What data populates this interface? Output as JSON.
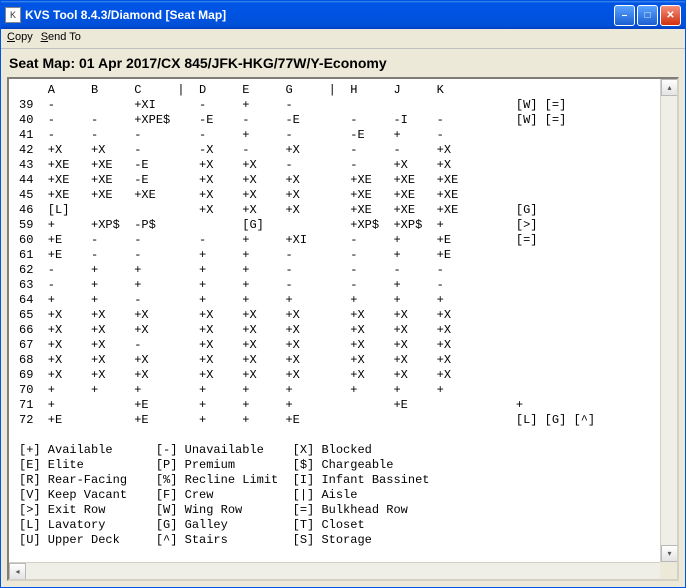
{
  "window": {
    "title": "KVS Tool 8.4.3/Diamond [Seat Map]"
  },
  "menu": {
    "copy": "Copy",
    "sendto": "Send To"
  },
  "header": "Seat Map: 01 Apr 2017/CX 845/JFK-HKG/77W/Y-Economy",
  "columns": [
    "A",
    "B",
    "C",
    "|",
    "D",
    "E",
    "G",
    "|",
    "H",
    "J",
    "K"
  ],
  "rows": [
    {
      "n": "39",
      "cells": [
        "-",
        "",
        "+XI",
        "",
        "-",
        "+",
        "-",
        "",
        "",
        "",
        "",
        "",
        "[W]",
        "[=]"
      ]
    },
    {
      "n": "40",
      "cells": [
        "-",
        "-",
        "+XPE$",
        "",
        "-E",
        "-",
        "-E",
        "",
        "-",
        "-I",
        "-",
        "",
        "[W]",
        "[=]"
      ]
    },
    {
      "n": "41",
      "cells": [
        "-",
        "-",
        "-",
        "",
        "-",
        "+",
        "-",
        "",
        "-E",
        "+",
        "-"
      ]
    },
    {
      "n": "42",
      "cells": [
        "+X",
        "+X",
        "-",
        "",
        "-X",
        "-",
        "+X",
        "",
        "-",
        "-",
        "+X"
      ]
    },
    {
      "n": "43",
      "cells": [
        "+XE",
        "+XE",
        "-E",
        "",
        "+X",
        "+X",
        "-",
        "",
        "-",
        "+X",
        "+X"
      ]
    },
    {
      "n": "44",
      "cells": [
        "+XE",
        "+XE",
        "-E",
        "",
        "+X",
        "+X",
        "+X",
        "",
        "+XE",
        "+XE",
        "+XE"
      ]
    },
    {
      "n": "45",
      "cells": [
        "+XE",
        "+XE",
        "+XE",
        "",
        "+X",
        "+X",
        "+X",
        "",
        "+XE",
        "+XE",
        "+XE"
      ]
    },
    {
      "n": "46",
      "cells": [
        "[L]",
        "",
        "",
        "",
        "+X",
        "+X",
        "+X",
        "",
        "+XE",
        "+XE",
        "+XE",
        "",
        "[G]"
      ]
    },
    {
      "n": "59",
      "cells": [
        "+",
        "+XP$",
        "-P$",
        "",
        "",
        "[G]",
        "",
        "",
        "+XP$",
        "+XP$",
        "+",
        "",
        "[>]"
      ]
    },
    {
      "n": "60",
      "cells": [
        "+E",
        "-",
        "-",
        "",
        "-",
        "+",
        "+XI",
        "",
        "-",
        "+",
        "+E",
        "",
        "[=]"
      ]
    },
    {
      "n": "61",
      "cells": [
        "+E",
        "-",
        "-",
        "",
        "+",
        "+",
        "-",
        "",
        "-",
        "+",
        "+E"
      ]
    },
    {
      "n": "62",
      "cells": [
        "-",
        "+",
        "+",
        "",
        "+",
        "+",
        "-",
        "",
        "-",
        "-",
        "-"
      ]
    },
    {
      "n": "63",
      "cells": [
        "-",
        "+",
        "+",
        "",
        "+",
        "+",
        "-",
        "",
        "-",
        "+",
        "-"
      ]
    },
    {
      "n": "64",
      "cells": [
        "+",
        "+",
        "-",
        "",
        "+",
        "+",
        "+",
        "",
        "+",
        "+",
        "+"
      ]
    },
    {
      "n": "65",
      "cells": [
        "+X",
        "+X",
        "+X",
        "",
        "+X",
        "+X",
        "+X",
        "",
        "+X",
        "+X",
        "+X"
      ]
    },
    {
      "n": "66",
      "cells": [
        "+X",
        "+X",
        "+X",
        "",
        "+X",
        "+X",
        "+X",
        "",
        "+X",
        "+X",
        "+X"
      ]
    },
    {
      "n": "67",
      "cells": [
        "+X",
        "+X",
        "-",
        "",
        "+X",
        "+X",
        "+X",
        "",
        "+X",
        "+X",
        "+X"
      ]
    },
    {
      "n": "68",
      "cells": [
        "+X",
        "+X",
        "+X",
        "",
        "+X",
        "+X",
        "+X",
        "",
        "+X",
        "+X",
        "+X"
      ]
    },
    {
      "n": "69",
      "cells": [
        "+X",
        "+X",
        "+X",
        "",
        "+X",
        "+X",
        "+X",
        "",
        "+X",
        "+X",
        "+X"
      ]
    },
    {
      "n": "70",
      "cells": [
        "+",
        "+",
        "+",
        "",
        "+",
        "+",
        "+",
        "",
        "+",
        "+",
        "+"
      ]
    },
    {
      "n": "71",
      "cells": [
        "+",
        "",
        "+E",
        "",
        "+",
        "+",
        "+",
        "",
        "",
        "+E",
        "",
        "",
        "+"
      ]
    },
    {
      "n": "72",
      "cells": [
        "+E",
        "",
        "+E",
        "",
        "+",
        "+",
        "+E",
        "",
        "",
        "",
        "",
        "",
        "[L]",
        "[G]",
        "[^]"
      ]
    }
  ],
  "legend": [
    [
      "[+]",
      "Available",
      "[-]",
      "Unavailable",
      "[X]",
      "Blocked"
    ],
    [
      "[E]",
      "Elite",
      "[P]",
      "Premium",
      "[$]",
      "Chargeable"
    ],
    [
      "[R]",
      "Rear-Facing",
      "[%]",
      "Recline Limit",
      "[I]",
      "Infant Bassinet"
    ],
    [
      "[V]",
      "Keep Vacant",
      "[F]",
      "Crew",
      "[|]",
      "Aisle"
    ],
    [
      "[>]",
      "Exit Row",
      "[W]",
      "Wing Row",
      "[=]",
      "Bulkhead Row"
    ],
    [
      "[L]",
      "Lavatory",
      "[G]",
      "Galley",
      "[T]",
      "Closet"
    ],
    [
      "[U]",
      "Upper Deck",
      "[^]",
      "Stairs",
      "[S]",
      "Storage"
    ]
  ]
}
